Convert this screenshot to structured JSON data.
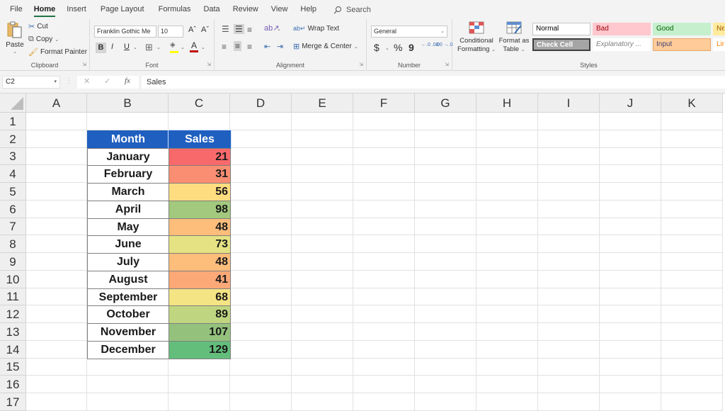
{
  "menu": {
    "tabs": [
      "File",
      "Home",
      "Insert",
      "Page Layout",
      "Formulas",
      "Data",
      "Review",
      "View",
      "Help"
    ],
    "active_tab": "Home",
    "search_label": "Search"
  },
  "ribbon": {
    "clipboard": {
      "label": "Clipboard",
      "paste": "Paste",
      "cut": "Cut",
      "copy": "Copy",
      "format_painter": "Format Painter"
    },
    "font": {
      "label": "Font",
      "font_name": "Franklin Gothic Me",
      "font_size": "10",
      "bold": "B",
      "italic": "I",
      "underline": "U",
      "grow": "Aˆ",
      "shrink": "Aˇ",
      "fill_color": "#ffff00",
      "font_color": "#c00000"
    },
    "alignment": {
      "label": "Alignment",
      "wrap_text": "Wrap Text",
      "merge_center": "Merge & Center"
    },
    "number": {
      "label": "Number",
      "format": "General",
      "currency": "$",
      "percent": "%",
      "comma": "9",
      "inc_decimal": "←.0 .00",
      "dec_decimal": ".00 →.0"
    },
    "styles": {
      "label": "Styles",
      "conditional_formatting": [
        "Conditional",
        "Formatting"
      ],
      "format_as_table": [
        "Format as",
        "Table"
      ],
      "cells": [
        {
          "name": "Normal",
          "bg": "#ffffff",
          "fg": "#000000",
          "border": "#c6c6c6"
        },
        {
          "name": "Bad",
          "bg": "#ffc7ce",
          "fg": "#9c0006",
          "border": "#ffc7ce"
        },
        {
          "name": "Good",
          "bg": "#c6efce",
          "fg": "#006100",
          "border": "#c6efce"
        },
        {
          "name": "Ne",
          "bg": "#ffeb9c",
          "fg": "#9c5700",
          "border": "#ffeb9c"
        },
        {
          "name": "Check Cell",
          "bg": "#a5a5a5",
          "fg": "#ffffff",
          "border": "#3f3f3f"
        },
        {
          "name": "Explanatory ...",
          "bg": "#ffffff",
          "fg": "#7f7f7f",
          "border": "#ffffff"
        },
        {
          "name": "Input",
          "bg": "#ffcc99",
          "fg": "#3f3f76",
          "border": "#e8a86b"
        },
        {
          "name": "Lin",
          "bg": "#ffffff",
          "fg": "#fa7d00",
          "border": "#ffffff"
        }
      ]
    }
  },
  "formula_bar": {
    "name_box": "C2",
    "cancel_icon": "✕",
    "enter_icon": "✓",
    "fx_label": "fx",
    "formula": "Sales"
  },
  "grid": {
    "columns": [
      "A",
      "B",
      "C",
      "D",
      "E",
      "F",
      "G",
      "H",
      "I",
      "J",
      "K"
    ],
    "rows": [
      "1",
      "2",
      "3",
      "4",
      "5",
      "6",
      "7",
      "8",
      "9",
      "10",
      "11",
      "12",
      "13",
      "14",
      "15",
      "16",
      "17"
    ]
  },
  "table": {
    "headers": [
      "Month",
      "Sales"
    ],
    "header_color": "#1f5fbf",
    "rows": [
      {
        "month": "January",
        "sales": "21",
        "color": "#f8696b"
      },
      {
        "month": "February",
        "sales": "31",
        "color": "#fa8e72"
      },
      {
        "month": "March",
        "sales": "56",
        "color": "#fedd81"
      },
      {
        "month": "April",
        "sales": "98",
        "color": "#a2c97d"
      },
      {
        "month": "May",
        "sales": "48",
        "color": "#fdbd7b"
      },
      {
        "month": "June",
        "sales": "73",
        "color": "#e5e283"
      },
      {
        "month": "July",
        "sales": "48",
        "color": "#fdbd7b"
      },
      {
        "month": "August",
        "sales": "41",
        "color": "#fca877"
      },
      {
        "month": "September",
        "sales": "68",
        "color": "#f4e483"
      },
      {
        "month": "October",
        "sales": "89",
        "color": "#c0d580"
      },
      {
        "month": "November",
        "sales": "107",
        "color": "#94c27c"
      },
      {
        "month": "December",
        "sales": "129",
        "color": "#63be7b"
      }
    ]
  }
}
